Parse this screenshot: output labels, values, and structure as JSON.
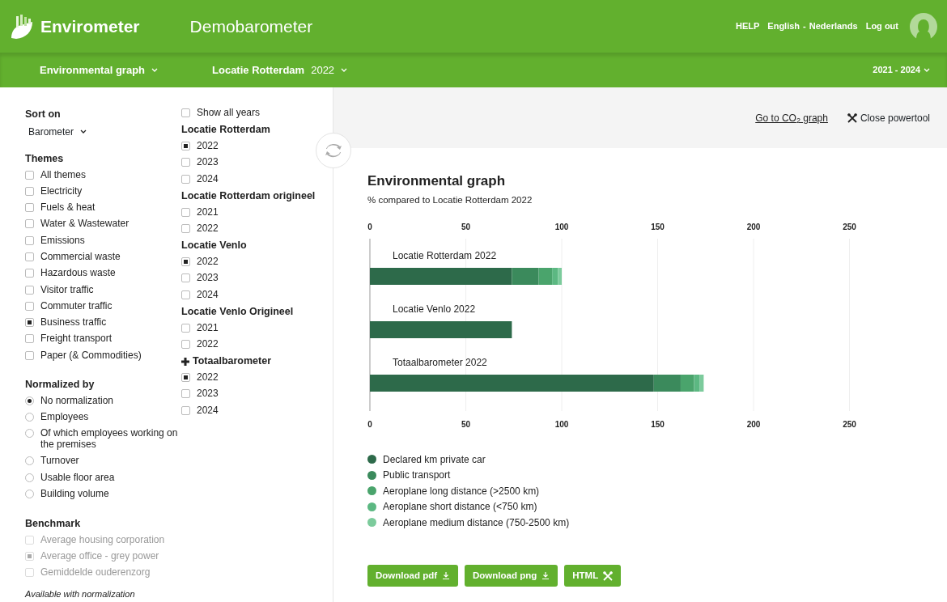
{
  "header": {
    "brand": "Envirometer",
    "barometer": "Demobarometer",
    "links": [
      {
        "label": "HELP",
        "kind": "link"
      },
      {
        "label": "English",
        "kind": "link"
      },
      {
        "label": "-",
        "kind": "sep"
      },
      {
        "label": "Nederlands",
        "kind": "link"
      },
      {
        "label": "Log out",
        "kind": "link"
      }
    ]
  },
  "subbar": {
    "graph_menu": "Environmental graph",
    "location": "Locatie Rotterdam",
    "year": "2022",
    "period": "2021 - 2024"
  },
  "sidebar": {
    "sort_on": {
      "title": "Sort on",
      "value": "Barometer"
    },
    "themes": {
      "title": "Themes",
      "items": [
        {
          "label": "All themes",
          "checked": false
        },
        {
          "label": "Electricity",
          "checked": false
        },
        {
          "label": "Fuels & heat",
          "checked": false
        },
        {
          "label": "Water & Wastewater",
          "checked": false
        },
        {
          "label": "Emissions",
          "checked": false
        },
        {
          "label": "Commercial waste",
          "checked": false
        },
        {
          "label": "Hazardous waste",
          "checked": false
        },
        {
          "label": "Visitor traffic",
          "checked": false
        },
        {
          "label": "Commuter traffic",
          "checked": false
        },
        {
          "label": "Business traffic",
          "checked": true
        },
        {
          "label": "Freight transport",
          "checked": false
        },
        {
          "label": "Paper (& Commodities)",
          "checked": false
        }
      ]
    },
    "normalized_by": {
      "title": "Normalized by",
      "options": [
        {
          "label": "No normalization",
          "selected": true
        },
        {
          "label": "Employees",
          "selected": false
        },
        {
          "label": "Of which employees working on the premises",
          "selected": false
        },
        {
          "label": "Turnover",
          "selected": false
        },
        {
          "label": "Usable floor area",
          "selected": false
        },
        {
          "label": "Building volume",
          "selected": false
        }
      ]
    },
    "benchmark": {
      "title": "Benchmark",
      "items": [
        {
          "label": "Average housing corporation",
          "checked": false,
          "disabled": true
        },
        {
          "label": "Average office - grey power",
          "checked": true,
          "disabled": true
        },
        {
          "label": "Gemiddelde ouderenzorg",
          "checked": false,
          "disabled": true
        }
      ],
      "note": "Available with normalization"
    },
    "show_all_years": {
      "label": "Show all years",
      "checked": false
    },
    "locations": [
      {
        "name": "Locatie Rotterdam",
        "kind": "location",
        "years": [
          {
            "label": "2022",
            "checked": true
          },
          {
            "label": "2023",
            "checked": false
          },
          {
            "label": "2024",
            "checked": false
          }
        ]
      },
      {
        "name": "Locatie Rotterdam origineel",
        "kind": "location",
        "years": [
          {
            "label": "2021",
            "checked": false
          },
          {
            "label": "2022",
            "checked": false
          }
        ]
      },
      {
        "name": "Locatie Venlo",
        "kind": "location",
        "years": [
          {
            "label": "2022",
            "checked": true
          },
          {
            "label": "2023",
            "checked": false
          },
          {
            "label": "2024",
            "checked": false
          }
        ]
      },
      {
        "name": "Locatie Venlo Origineel",
        "kind": "location",
        "years": [
          {
            "label": "2021",
            "checked": false
          },
          {
            "label": "2022",
            "checked": false
          }
        ]
      },
      {
        "name": "Totaalbarometer",
        "kind": "total",
        "years": [
          {
            "label": "2022",
            "checked": true
          },
          {
            "label": "2023",
            "checked": false
          },
          {
            "label": "2024",
            "checked": false
          }
        ]
      }
    ]
  },
  "toolbar": {
    "co2_link": "Go to CO$_{2}$ graph",
    "close": "Close powertool"
  },
  "graph": {
    "title": "Environmental graph",
    "subtitle": "% compared to Locatie Rotterdam 2022",
    "chart_data": {
      "type": "bar",
      "orientation": "horizontal",
      "stacked": true,
      "categories": [
        "Locatie Rotterdam 2022",
        "Locatie Venlo 2022",
        "Totaalbarometer 2022"
      ],
      "grid": true,
      "xlim": [
        0,
        250
      ],
      "xticks": [
        0,
        50,
        100,
        150,
        200,
        250
      ],
      "series": [
        {
          "name": "Declared km private car",
          "color": "#2d6a4a",
          "values": [
            74,
            74,
            148
          ]
        },
        {
          "name": "Public transport",
          "color": "#3b8a5c",
          "values": [
            14,
            0,
            14
          ]
        },
        {
          "name": "Aeroplane long distance (>2500 km)",
          "color": "#4aa46c",
          "values": [
            7,
            0,
            7
          ]
        },
        {
          "name": "Aeroplane short distance (<750 km)",
          "color": "#5cb882",
          "values": [
            3,
            0,
            3
          ]
        },
        {
          "name": "Aeroplane medium distance (750-2500 km)",
          "color": "#7ccb9c",
          "values": [
            2,
            0,
            2
          ]
        }
      ]
    },
    "bottom_axis_ticks": [
      "0",
      "50",
      "100",
      "150",
      "200",
      "250"
    ]
  },
  "downloads": [
    {
      "label": "Download pdf",
      "kind": "download"
    },
    {
      "label": "Download png",
      "kind": "download"
    },
    {
      "label": "HTML",
      "kind": "tools"
    }
  ]
}
